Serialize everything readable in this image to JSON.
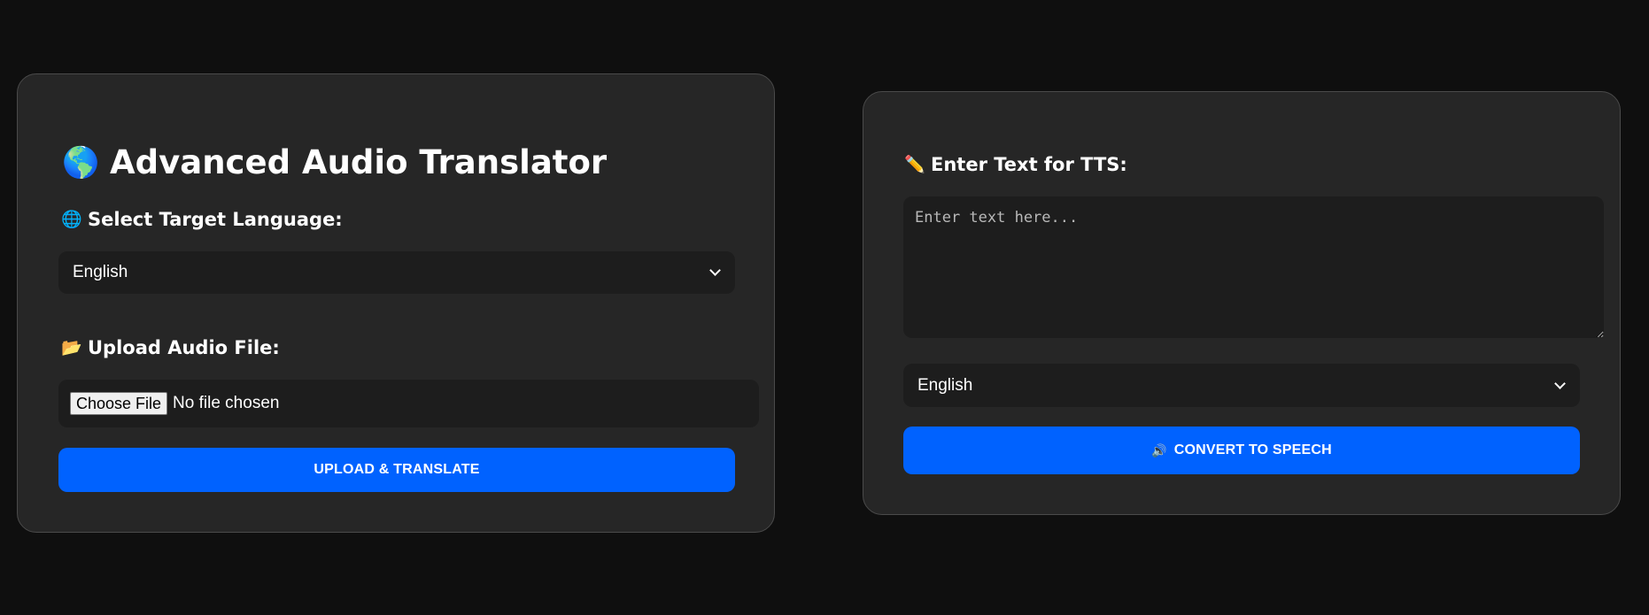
{
  "translator": {
    "title_emoji": "🌎",
    "title": "Advanced Audio Translator",
    "language_label_emoji": "🌐",
    "language_label": "Select Target Language:",
    "language_selected": "English",
    "upload_label_emoji": "📂",
    "upload_label": "Upload Audio File:",
    "choose_file_label": "Choose File",
    "file_status": "No file chosen",
    "upload_button_label": "UPLOAD & TRANSLATE"
  },
  "tts": {
    "label_emoji": "✏️",
    "label": "Enter Text for TTS:",
    "textarea_placeholder": "Enter text here...",
    "textarea_value": "",
    "language_selected": "English",
    "convert_button_emoji": "🔊",
    "convert_button_label": "CONVERT TO SPEECH"
  },
  "colors": {
    "page_background": "#0f0f0f",
    "card_background": "#262626",
    "card_border": "#4a4a4a",
    "field_background": "#1d1d1d",
    "accent": "#0062ff",
    "text": "#ffffff"
  },
  "icons": {
    "title_icon": "globe-americas-icon",
    "language_icon": "globe-meridians-icon",
    "upload_icon": "open-folder-icon",
    "tts_icon": "pencil-icon",
    "convert_icon": "speaker-icon",
    "select_icon": "chevron-down-icon"
  }
}
